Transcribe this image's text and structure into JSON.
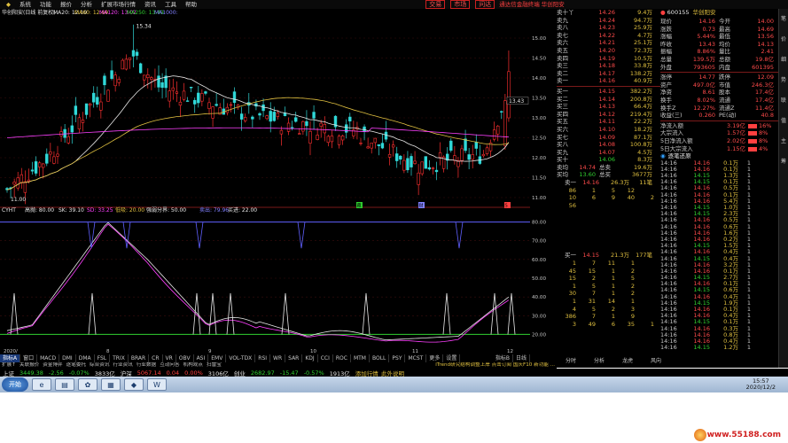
{
  "menu": {
    "items": [
      "系统",
      "功能",
      "报价",
      "分析",
      "扩展市场行情",
      "资讯",
      "工具",
      "帮助"
    ],
    "promo": "通达信金融终端 华创阳安",
    "right_buttons": [
      "交易",
      "市场",
      "问达"
    ]
  },
  "chart_header": {
    "title": "华创阳安(日线 前复权)",
    "ma20": "MA20: 12.10",
    "ma60": "MA60: 12.69",
    "ma120": "MA120: 13.02",
    "ma250": "MA250: 13.49",
    "ma1000": "MA1000:"
  },
  "price_chart": {
    "high_label": "15.34",
    "low_label": "11.00",
    "current_label": "13.43",
    "axis_ticks": [
      "15.00",
      "14.50",
      "14.00",
      "13.50",
      "13.00",
      "12.50",
      "12.00",
      "11.50",
      "11.00"
    ],
    "markers": [
      "藏",
      "财",
      "S"
    ]
  },
  "indicator_header": {
    "name": "CYHT",
    "hj": "高抛: 80.00",
    "sk": "SK: 39.10",
    "sd": "SD: 33.25",
    "dx": "低吸: 20.00",
    "qr": "强弱分界: 50.00",
    "mr": "卖出: 79.96",
    "md": "买进: 22.00"
  },
  "indicator_chart": {
    "axis_ticks": [
      "80.00",
      "70.00",
      "60.00",
      "50.00",
      "40.00",
      "30.00",
      "20.00"
    ]
  },
  "date_axis": {
    "labels": [
      "2020/",
      "8",
      "9",
      "10",
      "11",
      "12"
    ]
  },
  "tabs_bottom": [
    "指标A",
    "窗口",
    "MACD",
    "DMI",
    "DMA",
    "FSL",
    "TRIX",
    "BRAR",
    "CR",
    "VR",
    "OBV",
    "ASI",
    "EMV",
    "VOL-TDX",
    "RSI",
    "WR",
    "SAR",
    "KDJ",
    "CCI",
    "ROC",
    "MTM",
    "BOLL",
    "PSY",
    "MCST",
    "更多",
    "设置"
  ],
  "tabs_bottom_right": [
    "指标B",
    "日线"
  ],
  "tabs_sub": [
    "扩展↑",
    "关联报价",
    "资金博弈",
    "逐笔委托",
    "综合资讯",
    "行业资讯",
    "行业数据",
    "互动问答",
    "机构观点",
    "扫雷宝"
  ],
  "ticker_text": "iTrend研究结构调整上岸 点击订阅 国庆F10 新功能 ...",
  "quotes": {
    "sells": [
      {
        "label": "卖十丫",
        "price": "14.26",
        "vol": "9.4万"
      },
      {
        "label": "卖九",
        "price": "14.24",
        "vol": "94.7万"
      },
      {
        "label": "卖八",
        "price": "14.23",
        "vol": "25.9万"
      },
      {
        "label": "卖七",
        "price": "14.22",
        "vol": "4.7万"
      },
      {
        "label": "卖六",
        "price": "14.21",
        "vol": "25.1万"
      },
      {
        "label": "卖五",
        "price": "14.20",
        "vol": "72.3万"
      },
      {
        "label": "卖四",
        "price": "14.19",
        "vol": "10.5万"
      },
      {
        "label": "卖三",
        "price": "14.18",
        "vol": "33.8万"
      },
      {
        "label": "卖二",
        "price": "14.17",
        "vol": "138.2万"
      },
      {
        "label": "卖一",
        "price": "14.16",
        "vol": "40.9万"
      }
    ],
    "buys": [
      {
        "label": "买一",
        "price": "14.15",
        "vol": "382.2万"
      },
      {
        "label": "买二",
        "price": "14.14",
        "vol": "200.8万"
      },
      {
        "label": "买三",
        "price": "14.13",
        "vol": "66.4万"
      },
      {
        "label": "买四",
        "price": "14.12",
        "vol": "219.4万"
      },
      {
        "label": "买五",
        "price": "14.11",
        "vol": "22.2万"
      },
      {
        "label": "买六",
        "price": "14.10",
        "vol": "18.2万"
      },
      {
        "label": "买七",
        "price": "14.09",
        "vol": "87.1万"
      },
      {
        "label": "买八",
        "price": "14.08",
        "vol": "100.8万"
      },
      {
        "label": "买九",
        "price": "14.07",
        "vol": "4.5万"
      },
      {
        "label": "买十",
        "price": "14.06",
        "vol": "8.3万"
      }
    ],
    "avg_rows": [
      {
        "l": "卖均",
        "p": "14.74",
        "l2": "总卖",
        "v": "19.6万"
      },
      {
        "l": "买均",
        "p": "13.60",
        "l2": "总买",
        "v": "3677万"
      }
    ],
    "ticks_header": {
      "l": "卖一",
      "p": "14.16",
      "v": "26.3万",
      "n": "11笔"
    },
    "ticks_top": [
      [
        "86",
        "1",
        "5",
        "12"
      ],
      [
        "10",
        "6",
        "9",
        "40",
        "2"
      ],
      [
        "56",
        "",
        "",
        ""
      ]
    ],
    "ticks_header2": {
      "l": "买一",
      "p": "14.15",
      "v": "21.3万",
      "n": "177笔"
    },
    "ticks_bottom": [
      [
        "1",
        "7",
        "11",
        "1"
      ],
      [
        "45",
        "15",
        "1",
        "2"
      ],
      [
        "15",
        "2",
        "1",
        "5"
      ],
      [
        "1",
        "5",
        "1",
        "2"
      ],
      [
        "30",
        "7",
        "1",
        "2"
      ],
      [
        "1",
        "31",
        "14",
        "1"
      ],
      [
        "4",
        "5",
        "2",
        "3"
      ],
      [
        "386",
        "7",
        "1",
        "9"
      ],
      [
        "3",
        "49",
        "6",
        "35",
        "1"
      ]
    ]
  },
  "info": {
    "code": "600155",
    "name": "华创阳安",
    "rows": [
      {
        "a": "现价",
        "av": "14.16",
        "b": "今开",
        "bv": "14.00"
      },
      {
        "a": "涨跌",
        "av": "0.73",
        "b": "最高",
        "bv": "14.69"
      },
      {
        "a": "涨幅",
        "av": "5.44%",
        "b": "最低",
        "bv": "13.56"
      },
      {
        "a": "昨收",
        "av": "13.43",
        "b": "均价",
        "bv": "14.13"
      },
      {
        "a": "振幅",
        "av": "8.86%",
        "b": "量比",
        "bv": "2.41"
      },
      {
        "a": "总量",
        "av": "139.5万",
        "b": "总额",
        "bv": "19.8亿"
      },
      {
        "a": "外盘",
        "av": "793605",
        "b": "内盘",
        "bv": "601395"
      }
    ],
    "rows2": [
      {
        "a": "涨停",
        "av": "14.77",
        "b": "跌停",
        "bv": "12.09"
      },
      {
        "a": "资产",
        "av": "497.0亿",
        "b": "市值",
        "bv": "246.3亿"
      },
      {
        "a": "净资",
        "av": "8.61",
        "b": "股本",
        "bv": "17.4亿"
      },
      {
        "a": "换手",
        "av": "8.02%",
        "b": "流通",
        "bv": "17.4亿"
      },
      {
        "a": "换手Z",
        "av": "12.27%",
        "b": "流通Z",
        "bv": "11.4亿"
      },
      {
        "a": "收益(三)",
        "av": "0.260",
        "b": "PE(动)",
        "bv": "40.8"
      }
    ],
    "flows": [
      {
        "l": "净流入额",
        "v": "3.19亿",
        "r": "16%"
      },
      {
        "l": "大宗流入",
        "v": "1.57亿",
        "r": "8%"
      },
      {
        "l": "5日净流入额",
        "v": "2.02亿",
        "r": "8%"
      },
      {
        "l": "5日大宗流入",
        "v": "1.15亿",
        "r": "4%"
      }
    ],
    "trades_title": "逐笔还原",
    "trades": [
      [
        "14:16",
        "14.16",
        "0.1万",
        "1"
      ],
      [
        "14:16",
        "14.16",
        "0.1万",
        "1"
      ],
      [
        "14:16",
        "14.15",
        "1.3万",
        "1"
      ],
      [
        "14:16",
        "14.15",
        "0.1万",
        "1"
      ],
      [
        "14:16",
        "14.16",
        "0.5万",
        "1"
      ],
      [
        "14:16",
        "14.16",
        "0.1万",
        "1"
      ],
      [
        "14:16",
        "14.16",
        "5.4万",
        "1"
      ],
      [
        "14:16",
        "14.15",
        "1.0万",
        "1"
      ],
      [
        "14:16",
        "14.15",
        "2.3万",
        "1"
      ],
      [
        "14:16",
        "14.16",
        "0.5万",
        "1"
      ],
      [
        "14:16",
        "14.16",
        "0.6万",
        "1"
      ],
      [
        "14:16",
        "14.16",
        "1.6万",
        "1"
      ],
      [
        "14:16",
        "14.16",
        "0.2万",
        "1"
      ],
      [
        "14:16",
        "14.15",
        "1.5万",
        "1"
      ],
      [
        "14:16",
        "14.16",
        "0.4万",
        "1"
      ],
      [
        "14:16",
        "14.15",
        "0.4万",
        "1"
      ],
      [
        "14:16",
        "14.16",
        "3.2万",
        "1"
      ],
      [
        "14:16",
        "14.16",
        "0.1万",
        "1"
      ],
      [
        "14:16",
        "14.15",
        "2.7万",
        "1"
      ],
      [
        "14:16",
        "14.16",
        "0.1万",
        "1"
      ],
      [
        "14:16",
        "14.15",
        "0.6万",
        "1"
      ],
      [
        "14:16",
        "14.16",
        "0.4万",
        "1"
      ],
      [
        "14:16",
        "14.15",
        "1.9万",
        "1"
      ],
      [
        "14:16",
        "14.16",
        "0.1万",
        "1"
      ],
      [
        "14:16",
        "14.16",
        "0.4万",
        "1"
      ],
      [
        "14:16",
        "14.15",
        "0.1万",
        "1"
      ],
      [
        "14:16",
        "14.16",
        "0.3万",
        "1"
      ],
      [
        "14:16",
        "14.16",
        "0.8万",
        "1"
      ],
      [
        "14:16",
        "14.16",
        "0.4万",
        "1"
      ],
      [
        "14:16",
        "14.15",
        "1.2万",
        "1"
      ]
    ]
  },
  "side_tabs": [
    "分时",
    "分析",
    "龙虎",
    "风向"
  ],
  "bottom_side_tabs": [
    "笔",
    "价",
    "细",
    "势",
    "联",
    "值",
    "主",
    "筹"
  ],
  "index_bar": {
    "sh_label": "上证",
    "sh_val": "3449.38",
    "sh_chg": "-2.56",
    "sh_pct": "-0.07%",
    "sh_amt": "3833亿",
    "sz_label": "沪深",
    "sz_val": "5067.14",
    "sz_chg": "0.04",
    "sz_pct": "0.00%",
    "sz_amt": "3106亿",
    "cy_label": "创业",
    "cy_val": "2682.97",
    "cy_chg": "-15.47",
    "cy_pct": "-0.57%",
    "cy_amt": "1913亿",
    "extra": "添加行情_此外说明"
  },
  "taskbar": {
    "start": "开始",
    "time": "15:57",
    "date": "2020/12/2"
  },
  "watermark": "www.55188.com",
  "colors": {
    "up": "#ff3030",
    "down": "#30d8d8",
    "background": "#000000",
    "grid": "#5a1a1a"
  }
}
